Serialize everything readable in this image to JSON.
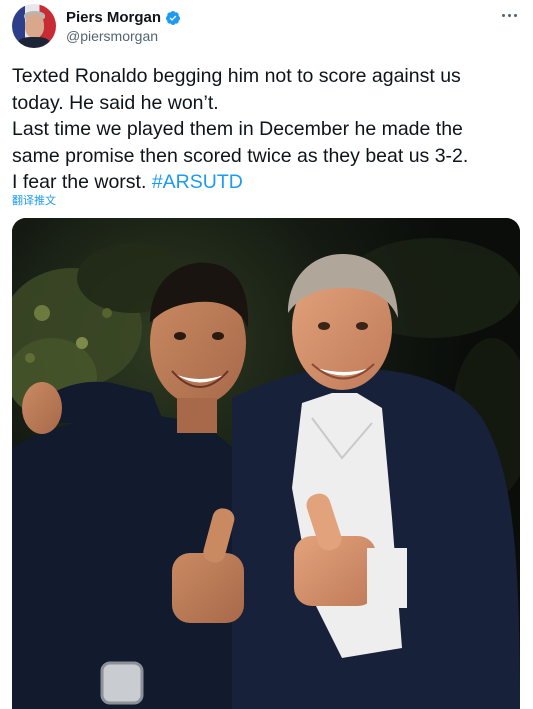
{
  "author": {
    "display_name": "Piers Morgan",
    "handle": "@piersmorgan",
    "verified": true,
    "avatar_icon": "profile-photo"
  },
  "tweet": {
    "lines": [
      "Texted Ronaldo begging him not to score against us",
      "today. He said he won’t.",
      "Last time we played them in December he made the",
      "same promise then scored twice as they beat us 3-2."
    ],
    "last_line_text": "I fear the worst. ",
    "hashtag": "#ARSUTD",
    "translate_label": "翻译推文"
  },
  "media": {
    "type": "photo"
  },
  "colors": {
    "accent": "#1d9bf0",
    "text_primary": "#0f1419",
    "text_secondary": "#536471"
  }
}
